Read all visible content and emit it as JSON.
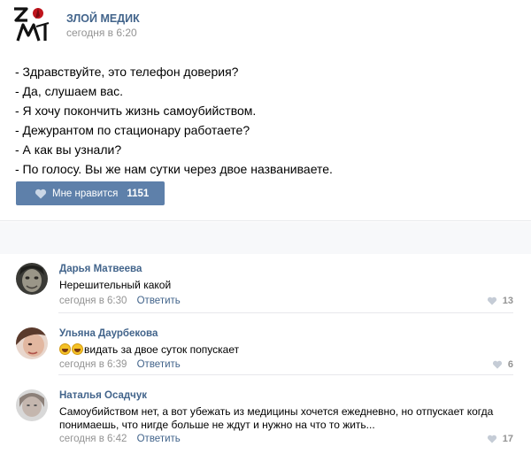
{
  "post": {
    "logo_icon": "zlm-logo-icon",
    "author": "ЗЛОЙ МЕДИК",
    "time": "сегодня в 6:20",
    "lines": [
      "- Здравствуйте, это телефон доверия?",
      "- Да, слушаем вас.",
      "- Я хочу покончить жизнь самоубийством.",
      "- Дежурантом по стационару работаете?",
      "- А как вы узнали?",
      "- По голосу. Вы же нам сутки через двое названиваете."
    ],
    "like_label": "Мне нравится",
    "like_count": "1151"
  },
  "comments": [
    {
      "author": "Дарья Матвеева",
      "text": "Нерешительный какой",
      "time": "сегодня в 6:30",
      "reply": "Ответить",
      "likes": "13"
    },
    {
      "author": "Ульяна Даурбекова",
      "text": "видать за двое суток попускает",
      "emoji_icons": [
        "laughing-emoji-icon",
        "laughing-emoji-icon"
      ],
      "time": "сегодня в 6:39",
      "reply": "Ответить",
      "likes": "6"
    },
    {
      "author": "Наталья Осадчук",
      "text": "Самоубийством нет, а вот убежать из медицины хочется ежедневно, но отпускает когда понимаешь, что нигде больше не ждут и нужно на что то жить...",
      "time": "сегодня в 6:42",
      "reply": "Ответить",
      "likes": "17"
    }
  ],
  "colors": {
    "link": "#42648b",
    "like_button": "#5e80aa",
    "muted": "#939393",
    "logo_red": "#c0141c"
  }
}
